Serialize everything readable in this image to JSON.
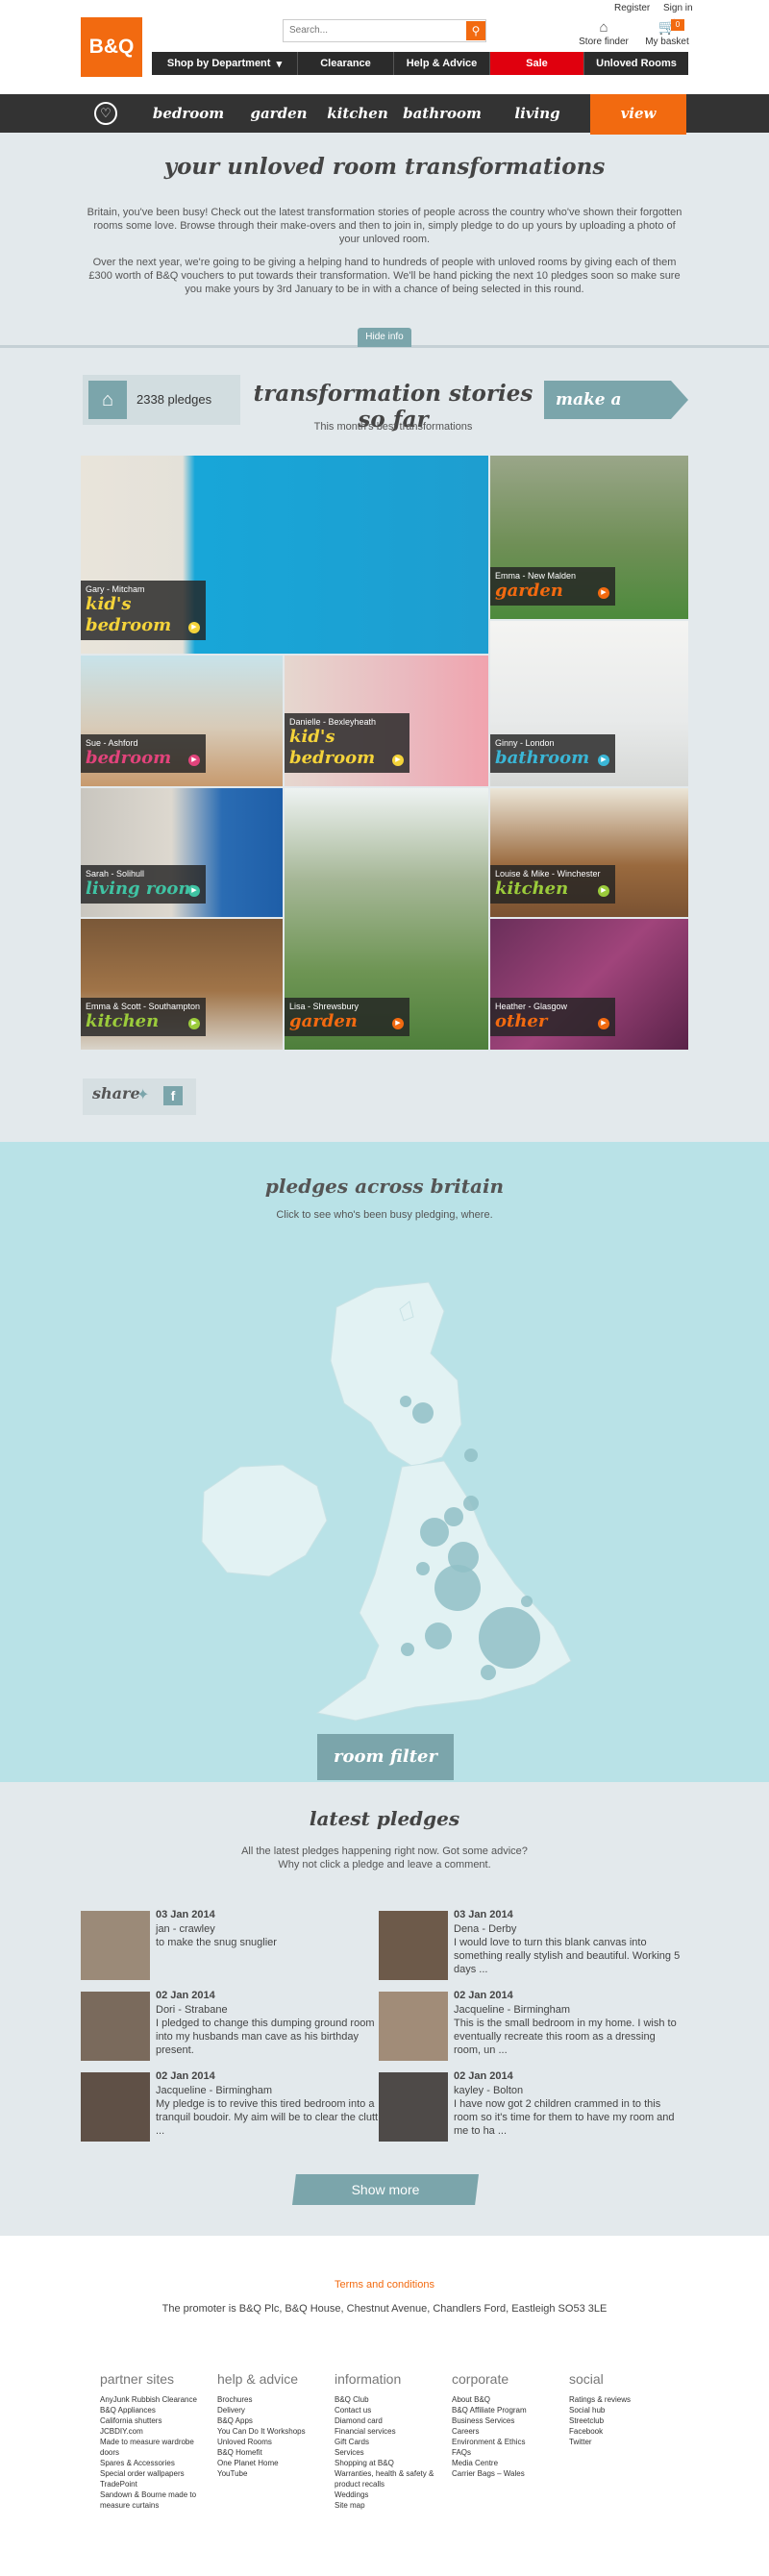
{
  "header": {
    "logo": "B&Q",
    "search_placeholder": "Search...",
    "register": "Register",
    "signin": "Sign in",
    "store_finder": "Store finder",
    "basket": "My basket",
    "basket_count": "0",
    "main_nav": [
      "Shop by Department",
      "Clearance",
      "Help & Advice",
      "Sale",
      "Unloved Rooms"
    ]
  },
  "subnav": {
    "items": [
      "bedroom",
      "garden",
      "kitchen",
      "bathroom",
      "living room"
    ],
    "active": "view pledges"
  },
  "intro": {
    "title": "your unloved room transformations",
    "p1": "Britain, you've been busy! Check out the latest transformation stories of people across the country who've shown their forgotten rooms some love. Browse through their make-overs and then to join in, simply pledge to do up yours by uploading a photo of your unloved room.",
    "p2": "Over the next year, we're going to be giving a helping hand to hundreds of people with unloved rooms by giving each of them £300 worth of B&Q vouchers to put towards their transformation. We'll be hand picking the next 10 pledges soon so make sure you make yours by 3rd January to be in with a chance of being selected in this round.",
    "hide_info": "Hide info"
  },
  "stories": {
    "pledge_count": "2338 pledges",
    "title": "transformation stories so far",
    "subtitle": "This month's best transformations",
    "make_pledge": "make a pledge",
    "tiles": [
      {
        "name": "Gary - Mitcham",
        "category": "kid's bedroom",
        "cat_color": "#f4d33a"
      },
      {
        "name": "Emma - New Malden",
        "category": "garden",
        "cat_color": "#f26a10"
      },
      {
        "name": "Sue - Ashford",
        "category": "bedroom",
        "cat_color": "#e2437b"
      },
      {
        "name": "Danielle - Bexleyheath",
        "category": "kid's bedroom",
        "cat_color": "#f4d33a"
      },
      {
        "name": "Ginny - London",
        "category": "bathroom",
        "cat_color": "#3ab6d6"
      },
      {
        "name": "Sarah - Solihull",
        "category": "living room",
        "cat_color": "#3fc3a3"
      },
      {
        "name": "Louise & Mike - Winchester",
        "category": "kitchen",
        "cat_color": "#9bcb3b"
      },
      {
        "name": "Emma & Scott - Southampton",
        "category": "kitchen",
        "cat_color": "#9bcb3b"
      },
      {
        "name": "Lisa - Shrewsbury",
        "category": "garden",
        "cat_color": "#f26a10"
      },
      {
        "name": "Heather - Glasgow",
        "category": "other",
        "cat_color": "#f26a10"
      }
    ]
  },
  "share": {
    "label": "share"
  },
  "map": {
    "title": "pledges across britain",
    "subtitle": "Click to see who's been busy pledging, where.",
    "room_filter": "room filter"
  },
  "latest": {
    "title": "latest pledges",
    "sub1": "All the latest pledges happening right now. Got some advice?",
    "sub2": "Why not click a pledge and leave a comment.",
    "show_more": "Show more",
    "items": [
      {
        "date": "03 Jan 2014",
        "name": "jan - crawley",
        "msg": "to make the snug snuglier"
      },
      {
        "date": "03 Jan 2014",
        "name": "Dena - Derby",
        "msg": "I would love to turn this blank canvas into something really stylish and beautiful. Working 5 days ..."
      },
      {
        "date": "02 Jan 2014",
        "name": "Dori - Strabane",
        "msg": "I pledged to change this dumping ground room into my husbands man cave as his birthday present."
      },
      {
        "date": "02 Jan 2014",
        "name": "Jacqueline - Birmingham",
        "msg": "This is the small bedroom in my home. I wish to eventually recreate this room as a dressing room, un ..."
      },
      {
        "date": "02 Jan 2014",
        "name": "Jacqueline - Birmingham",
        "msg": "My pledge is to revive this tired bedroom into a tranquil boudoir. My aim will be to clear the clutt ..."
      },
      {
        "date": "02 Jan 2014",
        "name": "kayley - Bolton",
        "msg": "I have now got 2 children crammed in to this room so it's time for them to have my room and me to ha ..."
      }
    ]
  },
  "footer": {
    "terms": "Terms and conditions",
    "promoter": "The promoter is B&Q Plc, B&Q House, Chestnut Avenue, Chandlers Ford, Eastleigh SO53 3LE",
    "columns": [
      {
        "heading": "partner sites",
        "links": [
          "AnyJunk Rubbish Clearance",
          "B&Q Appliances",
          "California shutters",
          "JCBDIY.com",
          "Made to measure wardrobe doors",
          "Spares & Accessories",
          "Special order wallpapers",
          "TradePoint",
          "Sandown & Bourne made to measure curtains"
        ]
      },
      {
        "heading": "help & advice",
        "links": [
          "Brochures",
          "Delivery",
          "B&Q Apps",
          "You Can Do It Workshops",
          "Unloved Rooms",
          "B&Q Homefit",
          "One Planet Home",
          "YouTube"
        ]
      },
      {
        "heading": "information",
        "links": [
          "B&Q Club",
          "Contact us",
          "Diamond card",
          "Financial services",
          "Gift Cards",
          "Services",
          "Shopping at B&Q",
          "Warranties, health & safety & product recalls",
          "Weddings",
          "Site map"
        ]
      },
      {
        "heading": "corporate",
        "links": [
          "About B&Q",
          "B&Q Affiliate Program",
          "Business Services",
          "Careers",
          "Environment & Ethics",
          "FAQs",
          "Media Centre",
          "Carrier Bags – Wales"
        ]
      },
      {
        "heading": "social",
        "links": [
          "Ratings & reviews",
          "Social hub",
          "Streetclub",
          "Facebook",
          "Twitter"
        ]
      }
    ]
  }
}
